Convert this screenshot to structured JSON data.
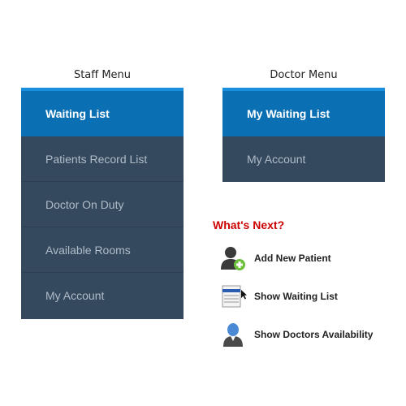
{
  "staff_menu": {
    "caption": "Staff Menu",
    "items": [
      {
        "label": "Waiting List",
        "active": true
      },
      {
        "label": "Patients Record List",
        "active": false
      },
      {
        "label": "Doctor On Duty",
        "active": false
      },
      {
        "label": "Available Rooms",
        "active": false
      },
      {
        "label": "My Account",
        "active": false
      }
    ]
  },
  "doctor_menu": {
    "caption": "Doctor Menu",
    "items": [
      {
        "label": "My Waiting List",
        "active": true
      },
      {
        "label": "My Account",
        "active": false
      }
    ]
  },
  "whats_next": {
    "title": "What's Next?",
    "actions": [
      {
        "label": "Add New Patient",
        "icon": "add-user-icon"
      },
      {
        "label": "Show Waiting List",
        "icon": "list-icon"
      },
      {
        "label": "Show Doctors Availability",
        "icon": "doctor-icon"
      }
    ]
  },
  "colors": {
    "menu_bg": "#34495e",
    "menu_active": "#0b6fb3",
    "menu_top_accent": "#1a8fdd",
    "menu_text": "#b0bcc8",
    "whats_next_title": "#cc0000"
  }
}
